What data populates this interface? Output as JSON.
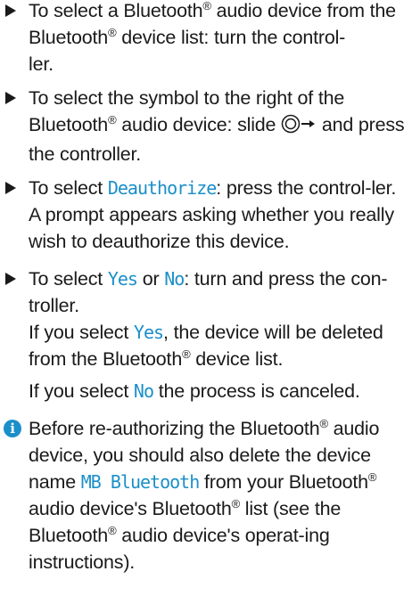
{
  "steps": [
    {
      "t1": "To select a Bluetooth",
      "reg": "®",
      "t2": " audio device from the Bluetooth",
      "t3": " device list: turn the control-",
      "t4": "ler."
    },
    {
      "t1": "To select the symbol to the right of the Bluetooth",
      "reg": "®",
      "t2": " audio device: slide ",
      "t3": " and press the controller."
    },
    {
      "t1": "To select ",
      "ui1": "Deauthorize",
      "t2": ": press the control-ler.",
      "result": "A prompt appears asking whether you really wish to deauthorize this device."
    },
    {
      "t1": "To select ",
      "ui_yes": "Yes",
      "t_or": " or ",
      "ui_no": "No",
      "t2": ": turn and press the con-troller.",
      "r1a": "If you select ",
      "r1b": ", the device will be deleted from the Bluetooth",
      "reg": "®",
      "r1c": " device list.",
      "r2a": "If you select ",
      "r2b": " the process is canceled."
    }
  ],
  "note": {
    "icon": "i",
    "t1": "Before re-authorizing the Bluetooth",
    "reg": "®",
    "t2": " audio device, you should also delete the device name ",
    "ui": "MB Bluetooth",
    "t3": " from your Bluetooth",
    "t4": " audio device's Bluetooth",
    "t5": " list (see the Bluetooth",
    "t6": " audio device's operat-ing instructions)."
  },
  "colors": {
    "accent": "#1b8fc9",
    "text": "#1a1a1a"
  }
}
